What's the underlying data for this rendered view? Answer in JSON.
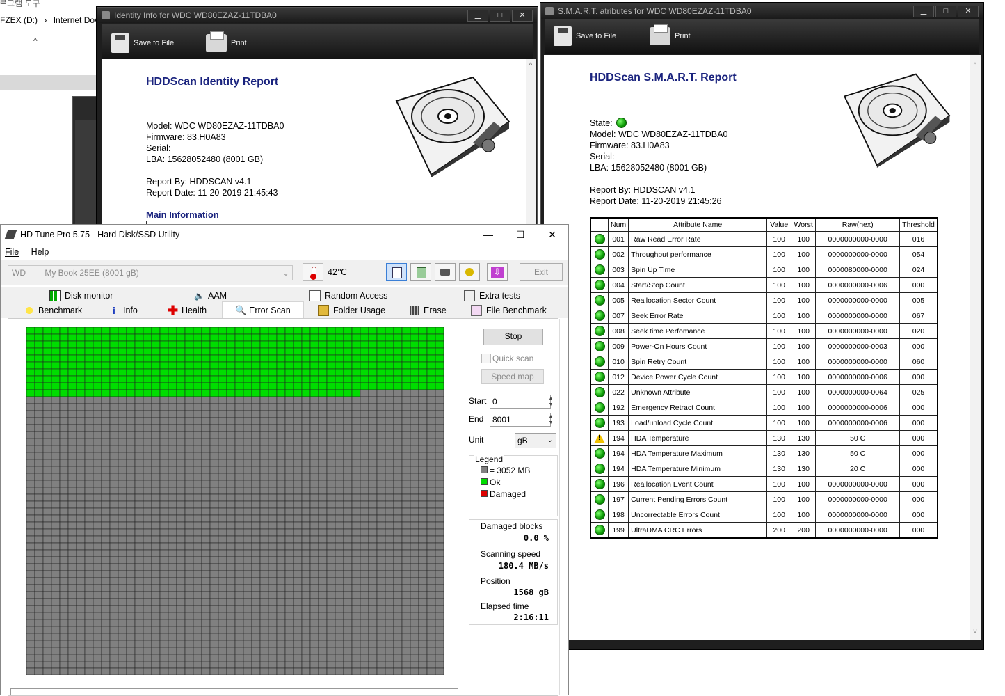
{
  "explorer": {
    "crumb_top": "프로그램 도구",
    "path_drive": "FZEX (D:)",
    "path_folder": "Internet Dov",
    "up_icon": "chevron-up-icon"
  },
  "identity_window": {
    "title": "Identity Info for WDC WD80EZAZ-11TDBA0",
    "save_label": "Save to File",
    "print_label": "Print",
    "report_title": "HDDScan Identity Report",
    "model": "Model: WDC WD80EZAZ-11TDBA0",
    "firmware": "Firmware: 83.H0A83",
    "serial": "Serial:",
    "lba": "LBA: 15628052480 (8001 GB)",
    "report_by": "Report By: HDDSCAN v4.1",
    "report_date": "Report Date: 11-20-2019 21:45:43",
    "main_info": "Main Information"
  },
  "smart_window": {
    "title": "S.M.A.R.T. atributes for WDC WD80EZAZ-11TDBA0",
    "save_label": "Save to File",
    "print_label": "Print",
    "report_title": "HDDScan S.M.A.R.T. Report",
    "state": "State:",
    "model": "Model: WDC WD80EZAZ-11TDBA0",
    "firmware": "Firmware: 83.H0A83",
    "serial": "Serial:",
    "lba": "LBA: 15628052480 (8001 GB)",
    "report_by": "Report By: HDDSCAN v4.1",
    "report_date": "Report Date: 11-20-2019 21:45:26",
    "columns": [
      "",
      "Num",
      "Attribute Name",
      "Value",
      "Worst",
      "Raw(hex)",
      "Threshold"
    ],
    "rows": [
      {
        "status": "ok",
        "num": "001",
        "name": "Raw Read Error Rate",
        "value": "100",
        "worst": "100",
        "raw": "0000000000-0000",
        "thr": "016"
      },
      {
        "status": "ok",
        "num": "002",
        "name": "Throughput performance",
        "value": "100",
        "worst": "100",
        "raw": "0000000000-0000",
        "thr": "054"
      },
      {
        "status": "ok",
        "num": "003",
        "name": "Spin Up Time",
        "value": "100",
        "worst": "100",
        "raw": "0000080000-0000",
        "thr": "024"
      },
      {
        "status": "ok",
        "num": "004",
        "name": "Start/Stop Count",
        "value": "100",
        "worst": "100",
        "raw": "0000000000-0006",
        "thr": "000"
      },
      {
        "status": "ok",
        "num": "005",
        "name": "Reallocation Sector Count",
        "value": "100",
        "worst": "100",
        "raw": "0000000000-0000",
        "thr": "005"
      },
      {
        "status": "ok",
        "num": "007",
        "name": "Seek Error Rate",
        "value": "100",
        "worst": "100",
        "raw": "0000000000-0000",
        "thr": "067"
      },
      {
        "status": "ok",
        "num": "008",
        "name": "Seek time Perfomance",
        "value": "100",
        "worst": "100",
        "raw": "0000000000-0000",
        "thr": "020"
      },
      {
        "status": "ok",
        "num": "009",
        "name": "Power-On Hours Count",
        "value": "100",
        "worst": "100",
        "raw": "0000000000-0003",
        "thr": "000"
      },
      {
        "status": "ok",
        "num": "010",
        "name": "Spin Retry Count",
        "value": "100",
        "worst": "100",
        "raw": "0000000000-0000",
        "thr": "060"
      },
      {
        "status": "ok",
        "num": "012",
        "name": "Device Power Cycle Count",
        "value": "100",
        "worst": "100",
        "raw": "0000000000-0006",
        "thr": "000"
      },
      {
        "status": "ok",
        "num": "022",
        "name": "Unknown Attribute",
        "value": "100",
        "worst": "100",
        "raw": "0000000000-0064",
        "thr": "025"
      },
      {
        "status": "ok",
        "num": "192",
        "name": "Emergency Retract Count",
        "value": "100",
        "worst": "100",
        "raw": "0000000000-0006",
        "thr": "000"
      },
      {
        "status": "ok",
        "num": "193",
        "name": "Load/unload Cycle Count",
        "value": "100",
        "worst": "100",
        "raw": "0000000000-0006",
        "thr": "000"
      },
      {
        "status": "warn",
        "num": "194",
        "name": "HDA Temperature",
        "value": "130",
        "worst": "130",
        "raw": "50 C",
        "thr": "000"
      },
      {
        "status": "ok",
        "num": "194",
        "name": "HDA Temperature Maximum",
        "value": "130",
        "worst": "130",
        "raw": "50 C",
        "thr": "000"
      },
      {
        "status": "ok",
        "num": "194",
        "name": "HDA Temperature Minimum",
        "value": "130",
        "worst": "130",
        "raw": "20 C",
        "thr": "000"
      },
      {
        "status": "ok",
        "num": "196",
        "name": "Reallocation Event Count",
        "value": "100",
        "worst": "100",
        "raw": "0000000000-0000",
        "thr": "000"
      },
      {
        "status": "ok",
        "num": "197",
        "name": "Current Pending Errors Count",
        "value": "100",
        "worst": "100",
        "raw": "0000000000-0000",
        "thr": "000"
      },
      {
        "status": "ok",
        "num": "198",
        "name": "Uncorrectable Errors Count",
        "value": "100",
        "worst": "100",
        "raw": "0000000000-0000",
        "thr": "000"
      },
      {
        "status": "ok",
        "num": "199",
        "name": "UltraDMA CRC Errors",
        "value": "200",
        "worst": "200",
        "raw": "0000000000-0000",
        "thr": "000"
      }
    ]
  },
  "hdtune": {
    "title": "HD Tune Pro 5.75 - Hard Disk/SSD Utility",
    "menu": {
      "file": "File",
      "help": "Help"
    },
    "drive_prefix": "WD",
    "drive_name": "My Book 25EE (8001 gB)",
    "temperature": "42℃",
    "exit_label": "Exit",
    "tabs_top": [
      "Disk monitor",
      "AAM",
      "Random Access",
      "Extra tests"
    ],
    "tabs_bottom": [
      "Benchmark",
      "Info",
      "Health",
      "Error Scan",
      "Folder Usage",
      "Erase",
      "File Benchmark"
    ],
    "active_tab": "Error Scan",
    "stop_label": "Stop",
    "quick_scan_label": "Quick scan",
    "speed_map_label": "Speed map",
    "start_label": "Start",
    "start_value": "0",
    "end_label": "End",
    "end_value": "8001",
    "unit_label": "Unit",
    "unit_value": "gB",
    "legend_title": "Legend",
    "legend_block": "= 3052 MB",
    "legend_ok": "Ok",
    "legend_damaged": "Damaged",
    "damaged_blocks_label": "Damaged blocks",
    "damaged_blocks_value": "0.0 %",
    "scanning_speed_label": "Scanning speed",
    "scanning_speed_value": "180.4 MB/s",
    "position_label": "Position",
    "position_value": "1568 gB",
    "elapsed_label": "Elapsed time",
    "elapsed_value": "2:16:11",
    "scan_progress_fraction": 0.196,
    "colors": {
      "ok": "#00dd00",
      "unscanned": "#808080",
      "damaged": "#dd0000"
    }
  }
}
